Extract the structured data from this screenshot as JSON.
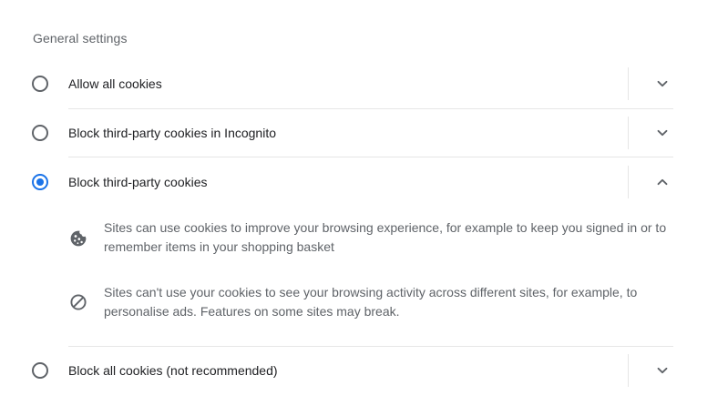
{
  "section": {
    "title": "General settings"
  },
  "options": [
    {
      "label": "Allow all cookies",
      "selected": false,
      "expanded": false
    },
    {
      "label": "Block third-party cookies in Incognito",
      "selected": false,
      "expanded": false
    },
    {
      "label": "Block third-party cookies",
      "selected": true,
      "expanded": true
    },
    {
      "label": "Block all cookies (not recommended)",
      "selected": false,
      "expanded": false
    }
  ],
  "details": [
    {
      "icon": "cookie-icon",
      "text": "Sites can use cookies to improve your browsing experience, for example to keep you signed in or to remember items in your shopping basket"
    },
    {
      "icon": "block-icon",
      "text": "Sites can't use your cookies to see your browsing activity across different sites, for example, to personalise ads. Features on some sites may break."
    }
  ],
  "colors": {
    "accent": "#1a73e8",
    "text_primary": "#202124",
    "text_secondary": "#5f6368",
    "divider": "#e6e6e6"
  }
}
